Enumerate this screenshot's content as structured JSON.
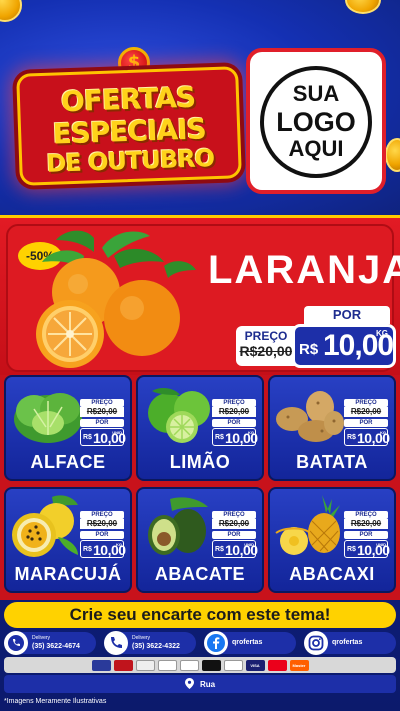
{
  "header": {
    "title_lines": [
      "OFERTAS",
      "ESPECIAIS",
      "DE OUTUBRO"
    ],
    "coin_symbol": "$",
    "logo_lines": [
      "SUA",
      "LOGO",
      "AQUI"
    ]
  },
  "hero": {
    "discount": "-50%",
    "name": "LARANJA",
    "por_label": "POR",
    "preco_label": "PREÇO",
    "old_price": "R$20,00",
    "currency": "R$",
    "price": "10,00",
    "unit": "KG"
  },
  "products": [
    {
      "name": "ALFACE",
      "preco_label": "PREÇO",
      "old_price": "R$20,00",
      "por_label": "POR",
      "currency": "R$",
      "price": "10,00",
      "unit": "UNID"
    },
    {
      "name": "LIMÃO",
      "preco_label": "PREÇO",
      "old_price": "R$20,00",
      "por_label": "POR",
      "currency": "R$",
      "price": "10,00",
      "unit": "KG"
    },
    {
      "name": "BATATA",
      "preco_label": "PREÇO",
      "old_price": "R$20,00",
      "por_label": "POR",
      "currency": "R$",
      "price": "10,00",
      "unit": "KG"
    },
    {
      "name": "MARACUJÁ",
      "preco_label": "PREÇO",
      "old_price": "R$20,00",
      "por_label": "POR",
      "currency": "R$",
      "price": "10,00",
      "unit": "KG"
    },
    {
      "name": "ABACATE",
      "preco_label": "PREÇO",
      "old_price": "R$20,00",
      "por_label": "POR",
      "currency": "R$",
      "price": "10,00",
      "unit": "UNID"
    },
    {
      "name": "ABACAXI",
      "preco_label": "PREÇO",
      "old_price": "R$20,00",
      "por_label": "POR",
      "currency": "R$",
      "price": "10,00",
      "unit": "UNID"
    }
  ],
  "cta": "Crie seu encarte com este tema!",
  "contacts": [
    {
      "label": "Delivery",
      "value": "(35) 3622-4674",
      "icon": "whatsapp-icon"
    },
    {
      "label": "Delivery",
      "value": "(35) 3622-4322",
      "icon": "phone-icon"
    },
    {
      "label": "",
      "value": "qrofertas",
      "icon": "facebook-icon"
    },
    {
      "label": "",
      "value": "qrofertas",
      "icon": "instagram-icon"
    }
  ],
  "payments": [
    "VISA",
    "Master"
  ],
  "address": "Rua",
  "footnote": "*Imagens Meramente Ilustrativas",
  "colors": {
    "brand_blue": "#1d2fa8",
    "brand_red": "#dd1a22",
    "accent_yellow": "#ffd200"
  }
}
